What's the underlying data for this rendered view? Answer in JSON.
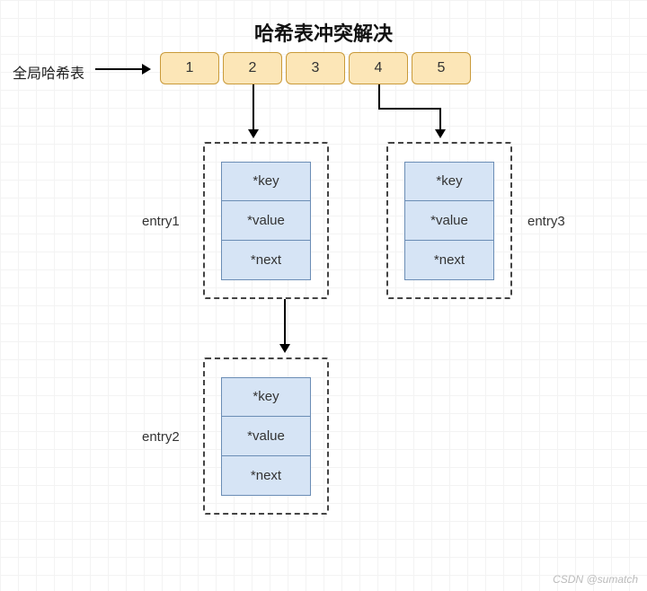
{
  "title": "哈希表冲突解决",
  "label_global": "全局哈希表",
  "buckets": {
    "b0": "1",
    "b1": "2",
    "b2": "3",
    "b3": "4",
    "b4": "5"
  },
  "entry": {
    "e1": {
      "label": "entry1",
      "key": "*key",
      "value": "*value",
      "next": "*next"
    },
    "e2": {
      "label": "entry2",
      "key": "*key",
      "value": "*value",
      "next": "*next"
    },
    "e3": {
      "label": "entry3",
      "key": "*key",
      "value": "*value",
      "next": "*next"
    }
  },
  "watermark": "CSDN @sumatch",
  "diagram_data": {
    "type": "hash-table-chaining",
    "description": "Hash table collision resolution via separate chaining (linked list)",
    "num_buckets": 5,
    "bucket_labels": [
      "1",
      "2",
      "3",
      "4",
      "5"
    ],
    "chains": {
      "2": [
        "entry1",
        "entry2"
      ],
      "4": [
        "entry3"
      ]
    },
    "entry_fields": [
      "*key",
      "*value",
      "*next"
    ]
  }
}
